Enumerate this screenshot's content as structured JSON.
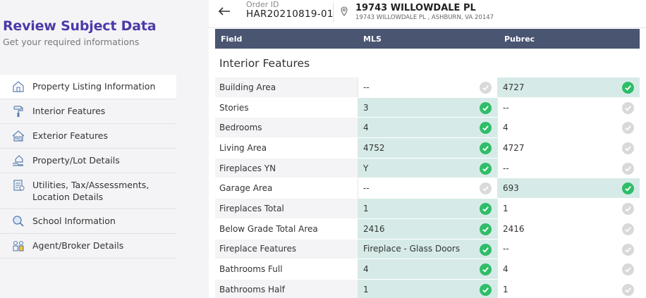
{
  "sidebar": {
    "title": "Review Subject Data",
    "subtitle": "Get your required informations",
    "items": [
      {
        "label": "Property Listing Information",
        "icon": "house-icon"
      },
      {
        "label": "Interior Features",
        "icon": "paint-roller-icon"
      },
      {
        "label": "Exterior Features",
        "icon": "house-exterior-icon"
      },
      {
        "label": "Property/Lot Details",
        "icon": "hand-house-icon"
      },
      {
        "label": "Utilities, Tax/Assessments, Location Details",
        "icon": "document-icon"
      },
      {
        "label": "School Information",
        "icon": "magnifier-icon"
      },
      {
        "label": "Agent/Broker Details",
        "icon": "agents-icon"
      }
    ]
  },
  "header": {
    "order_label": "Order ID",
    "order_id": "HAR20210819-01",
    "address_line1": "19743 WILLOWDALE PL",
    "address_line2": "19743 WILLOWDALE PL , ASHBURN, VA 20147"
  },
  "table": {
    "columns": [
      "Field",
      "MLS",
      "Pubrec"
    ],
    "section": "Interior Features",
    "rows": [
      {
        "field": "Building Area",
        "mls": "--",
        "pubrec": "4727",
        "selected": "pubrec"
      },
      {
        "field": "Stories",
        "mls": "3",
        "pubrec": "--",
        "selected": "mls"
      },
      {
        "field": "Bedrooms",
        "mls": "4",
        "pubrec": "4",
        "selected": "mls"
      },
      {
        "field": "Living Area",
        "mls": "4752",
        "pubrec": "4727",
        "selected": "mls"
      },
      {
        "field": "Fireplaces YN",
        "mls": "Y",
        "pubrec": "--",
        "selected": "mls"
      },
      {
        "field": "Garage Area",
        "mls": "--",
        "pubrec": "693",
        "selected": "pubrec"
      },
      {
        "field": "Fireplaces Total",
        "mls": "1",
        "pubrec": "1",
        "selected": "mls"
      },
      {
        "field": "Below Grade Total Area",
        "mls": "2416",
        "pubrec": "2416",
        "selected": "mls"
      },
      {
        "field": "Fireplace Features",
        "mls": "Fireplace - Glass Doors",
        "pubrec": "--",
        "selected": "mls"
      },
      {
        "field": "Bathrooms Full",
        "mls": "4",
        "pubrec": "4",
        "selected": "mls"
      },
      {
        "field": "Bathrooms Half",
        "mls": "1",
        "pubrec": "1",
        "selected": "mls"
      }
    ]
  },
  "colors": {
    "accent": "#4b3aa8",
    "header_bg": "#4a5572",
    "selected_bg": "#d6ebe8",
    "check_on": "#2fbd68",
    "check_off": "#d9d9d9"
  }
}
